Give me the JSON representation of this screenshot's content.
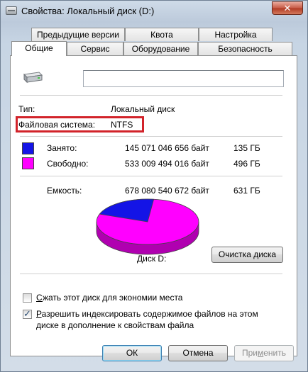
{
  "window": {
    "title": "Свойства: Локальный диск (D:)",
    "close_label": "✕"
  },
  "tabs": {
    "row1": [
      "Предыдущие версии",
      "Квота",
      "Настройка"
    ],
    "row2": [
      "Общие",
      "Сервис",
      "Оборудование",
      "Безопасность"
    ],
    "active": "Общие"
  },
  "general": {
    "name_value": "",
    "type_label": "Тип:",
    "type_value": "Локальный диск",
    "fs_label": "Файловая система:",
    "fs_value": "NTFS",
    "used_label": "Занято:",
    "used_bytes": "145 071 046 656 байт",
    "used_gb": "135 ГБ",
    "free_label": "Свободно:",
    "free_bytes": "533 009 494 016 байт",
    "free_gb": "496 ГБ",
    "capacity_label": "Емкость:",
    "capacity_bytes": "678 080 540 672 байт",
    "capacity_gb": "631 ГБ",
    "disk_label": "Диск D:",
    "cleanup_button": "Очистка диска",
    "compress_label_key": "С",
    "compress_label_rest": "жать этот диск для экономии места",
    "compress_checked": false,
    "index_label_key": "Р",
    "index_label_rest": "азрешить индексировать содержимое файлов на этом",
    "index_label_line2": "диске в дополнение к свойствам файла",
    "index_checked": true
  },
  "colors": {
    "used": "#1414e6",
    "free": "#ff00ff",
    "highlight": "#d2232a"
  },
  "chart_data": {
    "type": "pie",
    "categories": [
      "Занято",
      "Свободно"
    ],
    "values": [
      145071046656,
      533009494016
    ]
  },
  "buttons": {
    "ok": "ОК",
    "cancel": "Отмена",
    "apply_key": "м",
    "apply_pre": "При",
    "apply_post": "енить"
  }
}
